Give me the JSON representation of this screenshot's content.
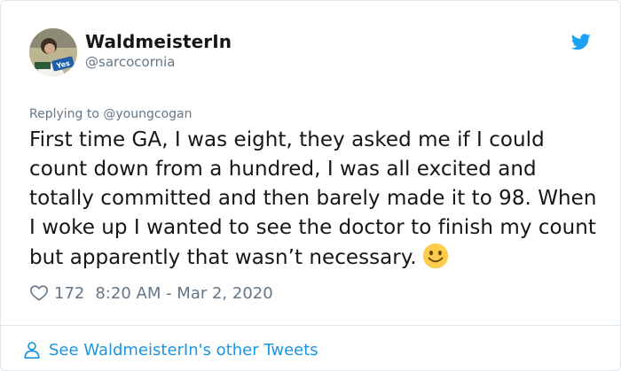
{
  "author": {
    "display_name": "WaldmeisterIn",
    "handle": "@sarcocornia",
    "avatar_badge": "Yes"
  },
  "reply": {
    "prefix": "Replying to",
    "mention": "@youngcogan"
  },
  "tweet": {
    "text": "First time GA, I was eight, they asked me if I could count down from a hundred, I was all excited and totally committed and then barely made it to 98. When I woke up I wanted to see the doctor to finish my count but apparently that wasn’t necessary.",
    "emoji": "slightly-smiling-face"
  },
  "meta": {
    "likes": "172",
    "timestamp": "8:20 AM - Mar 2, 2020"
  },
  "footer": {
    "link_label": "See WaldmeisterIn's other Tweets"
  },
  "colors": {
    "link_blue": "#1b95e0",
    "twitter_blue": "#1da1f2",
    "secondary_text": "#657786",
    "border": "#e1e8ed"
  }
}
